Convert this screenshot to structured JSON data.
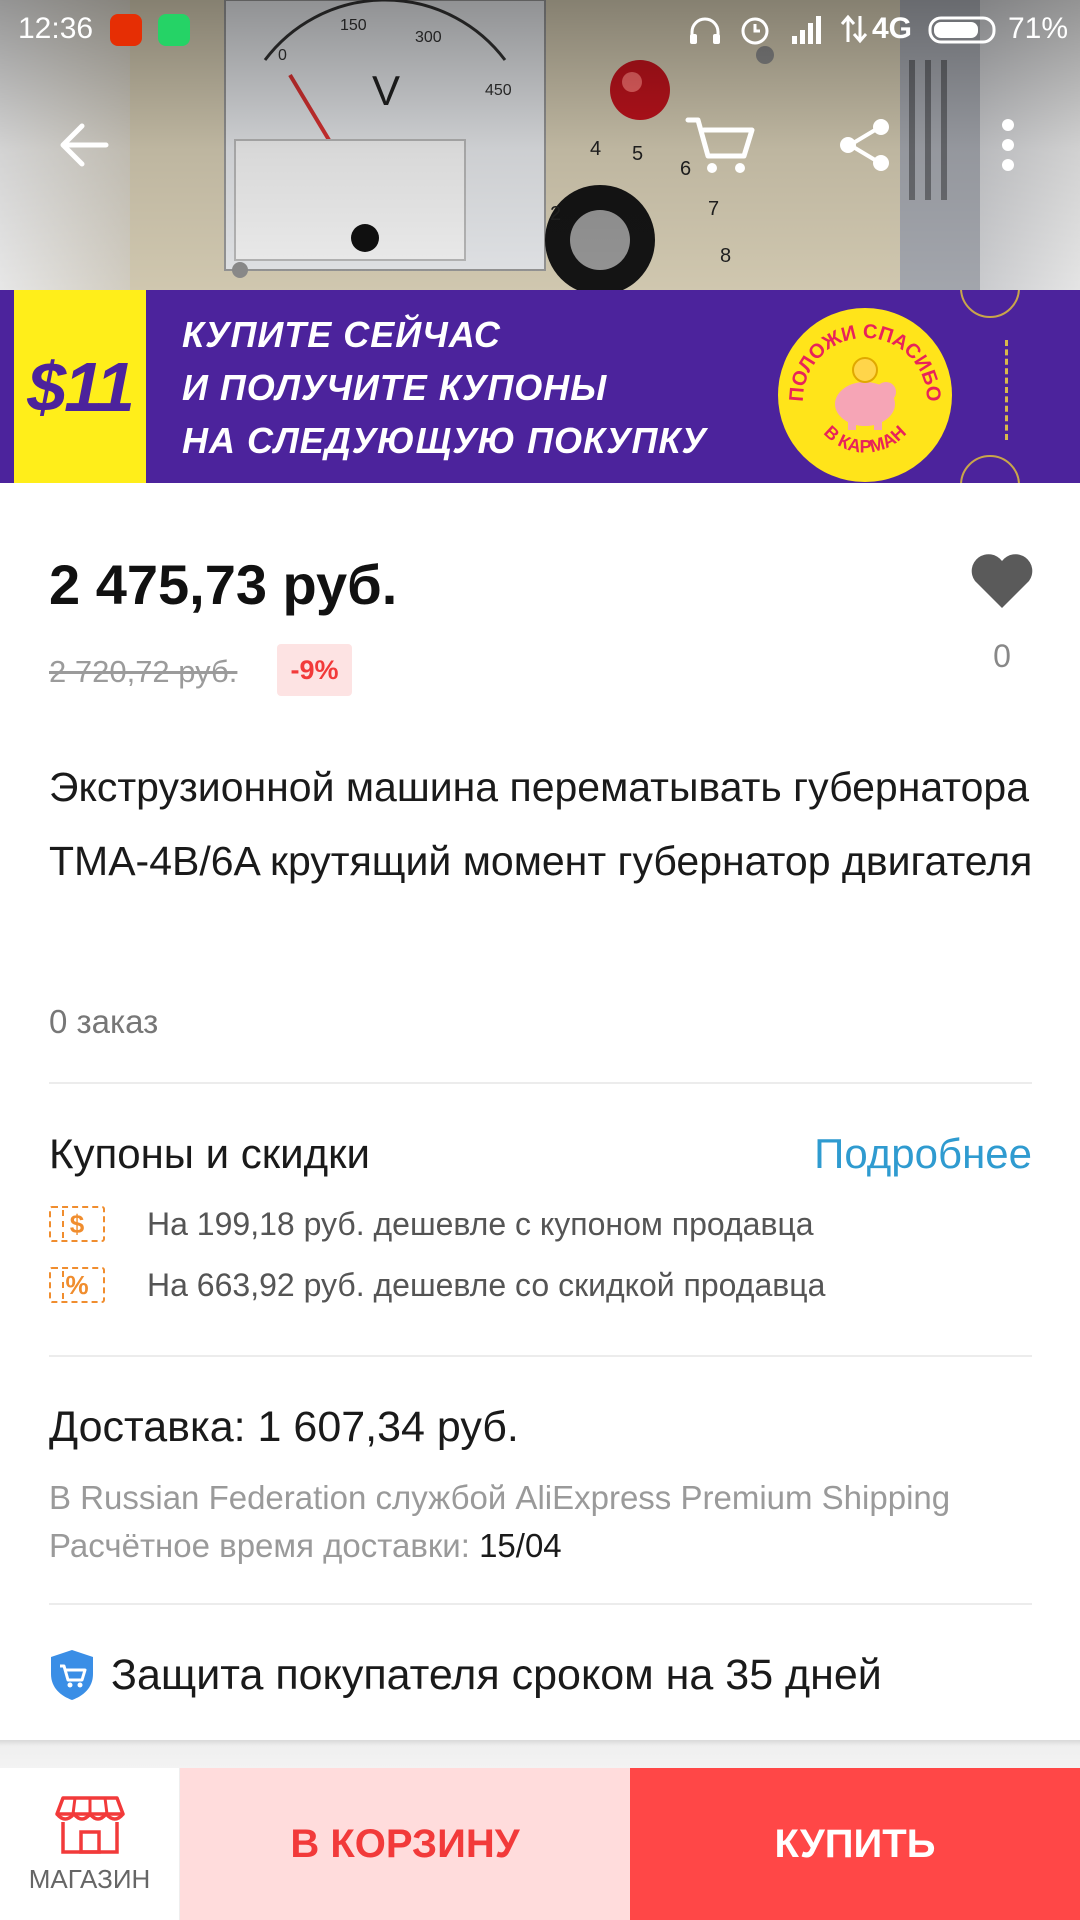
{
  "status_bar": {
    "time": "12:36",
    "network": "4G",
    "battery": "71%"
  },
  "toolbar": {
    "back_icon": "arrow-left-icon",
    "cart_icon": "cart-icon",
    "share_icon": "share-icon",
    "menu_icon": "more-vert-icon"
  },
  "promo": {
    "amount": "$11",
    "line1": "КУПИТЕ СЕЙЧАС",
    "line2": "И ПОЛУЧИТЕ КУПОНЫ",
    "line3": "НА СЛЕДУЮЩУЮ ПОКУПКУ",
    "badge_top": "ПОЛОЖИ СПАСИБО",
    "badge_bottom": "В КАРМАН",
    "colors": {
      "background": "#4c239c",
      "amount_bg": "#ffee1a",
      "badge": "#ffe41a"
    }
  },
  "product": {
    "price": "2 475,73 руб.",
    "old_price": "2 720,72 руб.",
    "discount": "-9%",
    "wishlist_count": "0",
    "title": "Экструзионной машина перематывать губернатора TMA-4B/6A крутящий момент губернатор двигателя",
    "orders": "0 заказ"
  },
  "coupons": {
    "heading": "Купоны и скидки",
    "more_link": "Подробнее",
    "items": [
      {
        "icon": "$",
        "text": "На 199,18 руб. дешевле с купоном продавца"
      },
      {
        "icon": "%",
        "text": "На 663,92 руб. дешевле со скидкой продавца"
      }
    ]
  },
  "delivery": {
    "heading": "Доставка: 1 607,34 руб.",
    "method": "В Russian Federation службой AliExpress Premium Shipping",
    "eta_label": "Расчётное время доставки: ",
    "eta_value": "15/04"
  },
  "protection": {
    "text": "Защита покупателя сроком на 35 дней"
  },
  "bottom_bar": {
    "store_label": "МАГАЗИН",
    "cart_label": "В КОРЗИНУ",
    "buy_label": "КУПИТЬ"
  },
  "colors": {
    "accent_red": "#ff4747",
    "link_blue": "#2f9bd0",
    "coupon_orange": "#f08d2e",
    "shield_blue": "#3a8ee6"
  }
}
